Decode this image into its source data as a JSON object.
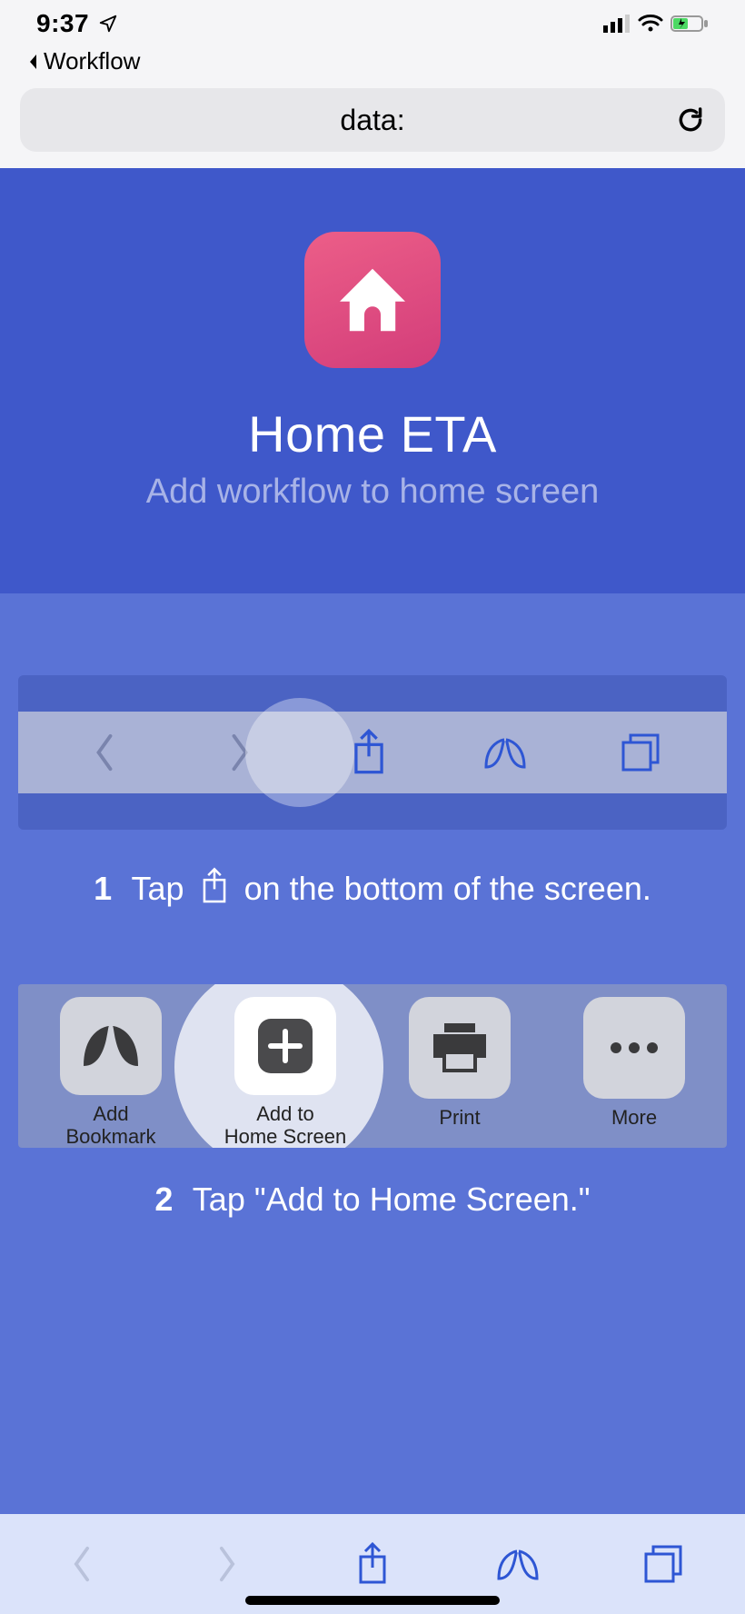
{
  "status": {
    "time": "9:37",
    "back_app": "Workflow"
  },
  "url_bar": {
    "text": "data:"
  },
  "hero": {
    "title": "Home ETA",
    "subtitle": "Add workflow to home screen"
  },
  "step1": {
    "number": "1",
    "text_before": "Tap",
    "text_after": "on the bottom of the screen."
  },
  "sheet": {
    "items": [
      {
        "label_line1": "Add",
        "label_line2": "Bookmark"
      },
      {
        "label_line1": "Add to",
        "label_line2": "Home Screen"
      },
      {
        "label_line1": "Print",
        "label_line2": ""
      },
      {
        "label_line1": "More",
        "label_line2": ""
      }
    ]
  },
  "step2": {
    "number": "2",
    "text": "Tap \"Add to Home Screen.\""
  }
}
